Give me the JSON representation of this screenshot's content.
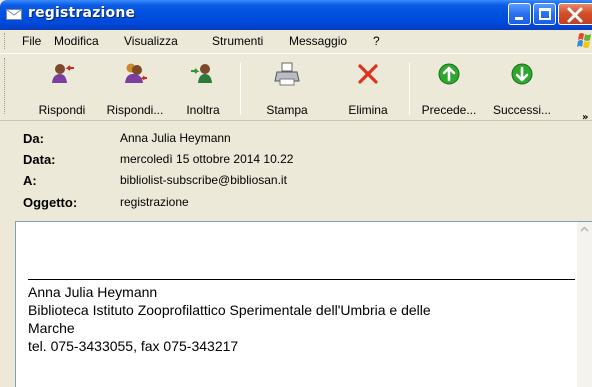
{
  "window": {
    "title": "registrazione"
  },
  "menu": [
    "File",
    "Modifica",
    "Visualizza",
    "Strumenti",
    "Messaggio",
    "?"
  ],
  "toolbar": {
    "reply": "Rispondi",
    "reply_all": "Rispondi...",
    "forward": "Inoltra",
    "print": "Stampa",
    "delete": "Elimina",
    "previous": "Precede...",
    "next": "Successi...",
    "more": "»"
  },
  "header": {
    "from_label": "Da:",
    "from_value": "Anna Julia Heymann",
    "date_label": "Data:",
    "date_value": "mercoledì 15 ottobre 2014 10.22",
    "to_label": "A:",
    "to_value": "bibliolist-subscribe@bibliosan.it",
    "subject_label": "Oggetto:",
    "subject_value": "registrazione"
  },
  "body": {
    "sig_name": "Anna Julia Heymann",
    "sig_line1": "Biblioteca Istituto Zooprofilattico Sperimentale dell'Umbria e delle",
    "sig_line2": "Marche",
    "sig_phone": "tel. 075-3433055, fax 075-343217"
  },
  "icons": {
    "reply": "reply-icon",
    "reply_all": "reply-all-icon",
    "forward": "forward-icon",
    "print": "printer-icon",
    "delete": "delete-x-icon",
    "previous": "arrow-up-circle-icon",
    "next": "arrow-down-circle-icon"
  },
  "colors": {
    "titlebar": "#0050E0",
    "delete": "#E0301E",
    "nav_green": "#2DA82D"
  }
}
